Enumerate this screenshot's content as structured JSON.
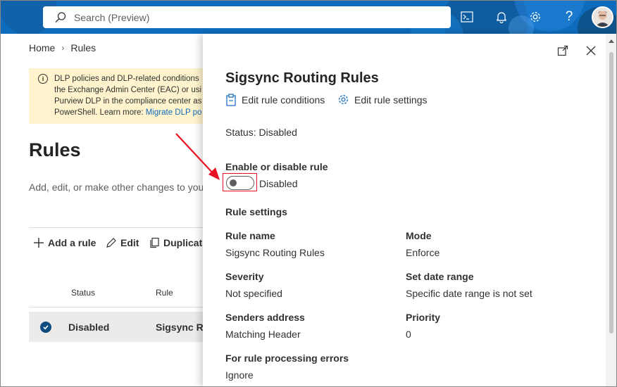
{
  "topbar": {
    "search_placeholder": "Search (Preview)",
    "icons": [
      "terminal-icon",
      "bell-icon",
      "gear-icon",
      "help-icon"
    ],
    "help_glyph": "?",
    "accent": "#0f6cbd"
  },
  "breadcrumb": {
    "home": "Home",
    "current": "Rules"
  },
  "info_bar": {
    "lines": [
      "DLP policies and DLP-related conditions",
      "the Exchange Admin Center (EAC) or usi",
      "Purview DLP in the compliance center as",
      "PowerShell. Learn more: "
    ],
    "link": "Migrate DLP po",
    "background": "#fff4ce"
  },
  "page": {
    "title": "Rules",
    "description": "Add, edit, or make other changes to you"
  },
  "commands": {
    "add": "Add a rule",
    "edit": "Edit",
    "duplicate": "Duplicate"
  },
  "table": {
    "headers": {
      "status": "Status",
      "rule": "Rule"
    },
    "rows": [
      {
        "status": "Disabled",
        "rule": "Sigsync Ro"
      }
    ]
  },
  "panel": {
    "title": "Sigsync Routing Rules",
    "edit_conditions": "Edit rule conditions",
    "edit_settings": "Edit rule settings",
    "status": "Status: Disabled",
    "toggle_heading": "Enable or disable rule",
    "toggle_state": "Disabled",
    "settings_heading": "Rule settings",
    "fields": {
      "rule_name_label": "Rule name",
      "rule_name_value": "Sigsync Routing Rules",
      "mode_label": "Mode",
      "mode_value": "Enforce",
      "severity_label": "Severity",
      "severity_value": "Not specified",
      "date_range_label": "Set date range",
      "date_range_value": "Specific date range is not set",
      "senders_label": "Senders address",
      "senders_value": "Matching Header",
      "priority_label": "Priority",
      "priority_value": "0",
      "errors_label": "For rule processing errors",
      "errors_value": "Ignore"
    }
  },
  "annotation_color": "#e81123"
}
